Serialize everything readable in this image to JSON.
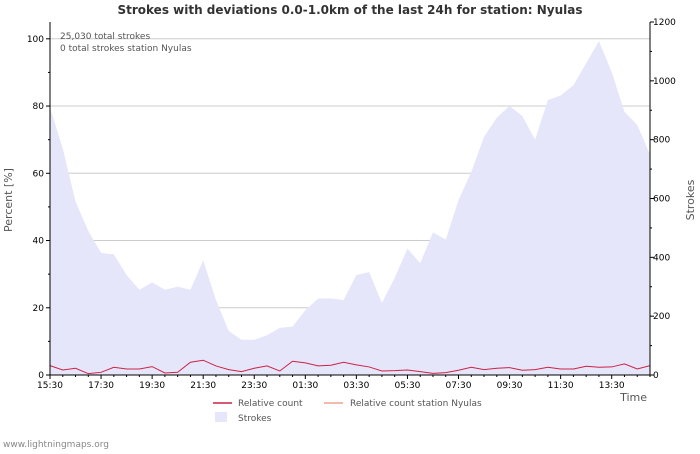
{
  "page": {
    "footer": "www.lightningmaps.org"
  },
  "chart_data": {
    "type": "area",
    "title": "Strokes with deviations 0.0-1.0km of the last 24h for station: Nyulas",
    "annotations": [
      "25,030 total strokes",
      "0 total strokes station Nyulas"
    ],
    "xlabel": "Time",
    "ylabel_left": "Percent   [%]",
    "ylabel_right": "Strokes",
    "x_tick_labels": [
      "15:30",
      "17:30",
      "19:30",
      "21:30",
      "23:30",
      "01:30",
      "03:30",
      "05:30",
      "07:30",
      "09:30",
      "11:30",
      "13:30"
    ],
    "x_tick_index": [
      0,
      4,
      8,
      12,
      16,
      20,
      24,
      28,
      32,
      36,
      40,
      44
    ],
    "y_left": {
      "ticks": [
        0,
        20,
        40,
        60,
        80,
        100
      ],
      "ylim": [
        0,
        105
      ]
    },
    "y_right": {
      "ticks": [
        0,
        200,
        400,
        600,
        800,
        1000,
        1200
      ],
      "ylim": [
        0,
        1200
      ]
    },
    "grid": true,
    "colors": {
      "strokes_fill": "#e6e6fb",
      "relative": "#cc2244",
      "relative_station": "#f0a090",
      "grid": "#cccccc",
      "axis": "#000000"
    },
    "legend": {
      "placement": "bottom",
      "entries": [
        {
          "label": "Relative count",
          "color": "#cc2244",
          "kind": "line"
        },
        {
          "label": "Relative count station Nyulas",
          "color": "#f0a090",
          "kind": "line"
        },
        {
          "label": "Strokes",
          "color": "#e6e6fb",
          "kind": "area"
        }
      ]
    },
    "series": [
      {
        "name": "Strokes",
        "axis": "right",
        "kind": "area",
        "values": [
          910,
          770,
          590,
          490,
          415,
          410,
          340,
          290,
          315,
          290,
          300,
          290,
          390,
          255,
          150,
          120,
          120,
          135,
          160,
          165,
          220,
          260,
          260,
          255,
          340,
          350,
          245,
          330,
          430,
          380,
          485,
          460,
          595,
          690,
          810,
          875,
          915,
          880,
          800,
          935,
          950,
          985,
          1060,
          1135,
          1030,
          895,
          850,
          750
        ]
      },
      {
        "name": "Relative count",
        "axis": "left",
        "kind": "line",
        "values": [
          2.8,
          1.5,
          2.0,
          0.4,
          0.8,
          2.3,
          1.8,
          1.8,
          2.5,
          0.6,
          0.8,
          3.8,
          4.4,
          2.7,
          1.6,
          1.0,
          2.0,
          2.7,
          1.2,
          4.1,
          3.6,
          2.7,
          2.9,
          3.8,
          3.0,
          2.4,
          1.2,
          1.3,
          1.5,
          1.0,
          0.5,
          0.7,
          1.4,
          2.3,
          1.6,
          2.0,
          2.2,
          1.4,
          1.6,
          2.3,
          1.8,
          1.8,
          2.6,
          2.3,
          2.4,
          3.3,
          1.8,
          2.8
        ]
      },
      {
        "name": "Relative count station Nyulas",
        "axis": "left",
        "kind": "line",
        "values": [
          0,
          0,
          0,
          0,
          0,
          0,
          0,
          0,
          0,
          0,
          0,
          0,
          0,
          0,
          0,
          0,
          0,
          0,
          0,
          0,
          0,
          0,
          0,
          0,
          0,
          0,
          0,
          0,
          0,
          0,
          0,
          0,
          0,
          0,
          0,
          0,
          0,
          0,
          0,
          0,
          0,
          0,
          0,
          0,
          0,
          0,
          0,
          0
        ]
      }
    ]
  }
}
